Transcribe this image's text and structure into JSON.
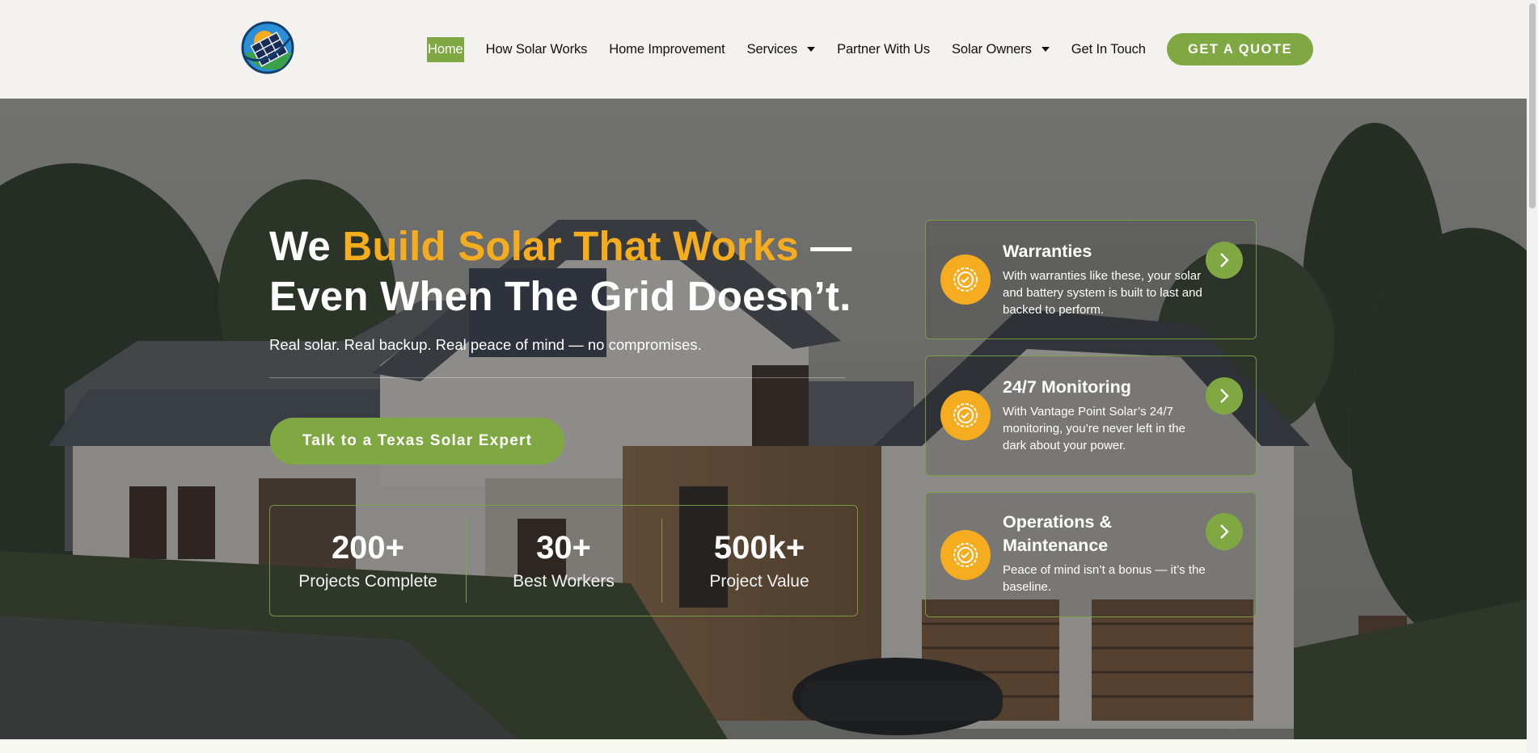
{
  "header": {
    "logo_icon": "solar-panel-globe-logo",
    "nav": [
      {
        "label": "Home",
        "active": true,
        "dropdown": false
      },
      {
        "label": "How Solar Works",
        "active": false,
        "dropdown": false
      },
      {
        "label": "Home Improvement",
        "active": false,
        "dropdown": false
      },
      {
        "label": "Services",
        "active": false,
        "dropdown": true
      },
      {
        "label": "Partner With Us",
        "active": false,
        "dropdown": false
      },
      {
        "label": "Solar Owners",
        "active": false,
        "dropdown": true
      },
      {
        "label": "Get In Touch",
        "active": false,
        "dropdown": false
      }
    ],
    "cta_label": "GET A QUOTE"
  },
  "hero": {
    "headline_part1": "We ",
    "headline_accent": "Build Solar That Works",
    "headline_part2": " — Even When The Grid Doesn’t.",
    "subheadline": "Real solar. Real backup. Real peace of mind — no compromises.",
    "cta_label": "Talk to a Texas Solar Expert",
    "stats": [
      {
        "value": "200+",
        "label": "Projects Complete"
      },
      {
        "value": "30+",
        "label": "Best Workers"
      },
      {
        "value": "500k+",
        "label": "Project Value"
      }
    ],
    "cards": [
      {
        "title": "Warranties",
        "text": "With warranties like these, your solar and battery system is built to last and backed to perform.",
        "icon": "award-badge-icon"
      },
      {
        "title": "24/7 Monitoring",
        "text": "With Vantage Point Solar’s 24/7 monitoring, you’re never left in the dark about your power.",
        "icon": "award-badge-icon"
      },
      {
        "title": "Operations & Maintenance",
        "text": "Peace of mind isn’t a bonus — it’s the baseline.",
        "icon": "award-badge-icon"
      }
    ]
  },
  "colors": {
    "brand_green": "#7fa843",
    "accent_yellow": "#f5ac1f",
    "header_bg": "#f4f2ee"
  }
}
